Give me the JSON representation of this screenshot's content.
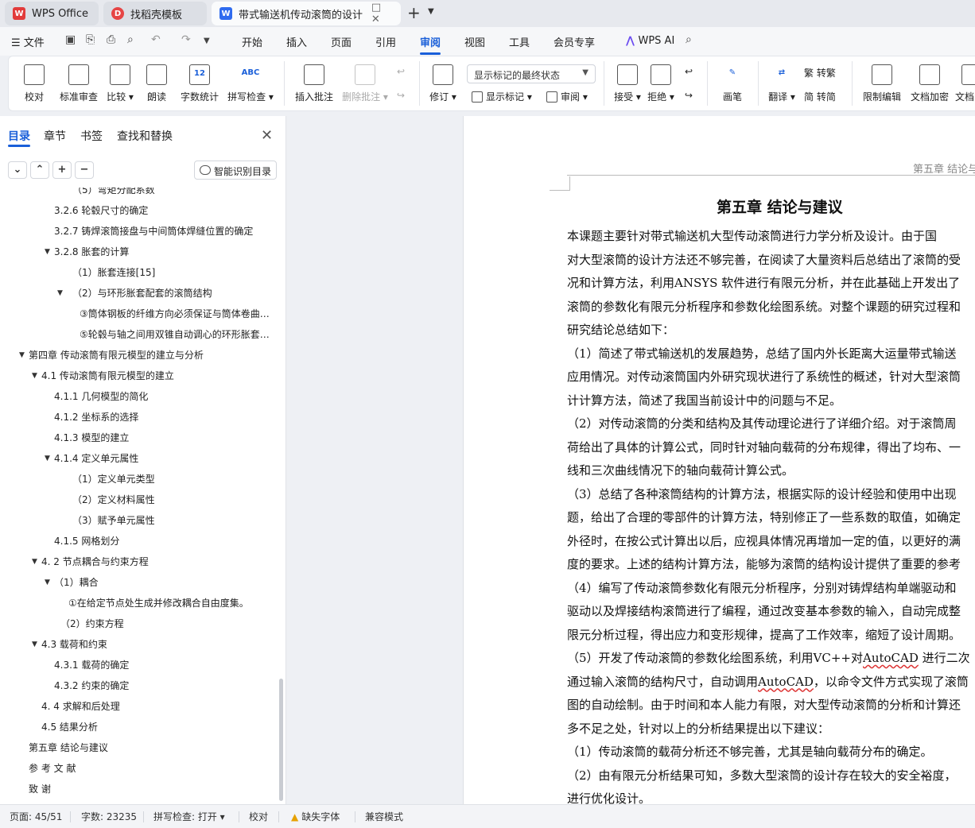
{
  "tabs": [
    {
      "title": "WPS Office",
      "logo": "W",
      "logo_color": "#e23b3b"
    },
    {
      "title": "找稻壳模板",
      "logo": "D",
      "logo_color": "#e64545"
    },
    {
      "title": "带式输送机传动滚筒的设计 说",
      "logo": "W",
      "logo_color": "#2f6bef",
      "extra": "□ ✕"
    }
  ],
  "new_tab": "+",
  "menu": {
    "file_label": "☰ 文件",
    "items": [
      "开始",
      "插入",
      "页面",
      "引用",
      "审阅",
      "视图",
      "工具",
      "会员专享"
    ],
    "active": "审阅",
    "wps_ai": "WPS AI"
  },
  "ribbon": {
    "buttons": [
      {
        "label": "校对",
        "icon": "proofread-icon"
      },
      {
        "label": "标准审查",
        "icon": "standard-review-icon"
      },
      {
        "label": "比较 ▾",
        "icon": "compare-icon"
      },
      {
        "label": "朗读",
        "icon": "read-aloud-icon"
      },
      {
        "label": "字数统计",
        "icon": "word-count-icon",
        "glyph": "12"
      },
      {
        "label": "拼写检查 ▾",
        "icon": "spell-check-icon",
        "glyph": "ABC"
      },
      {
        "label": "插入批注",
        "icon": "insert-comment-icon"
      },
      {
        "label": "删除批注 ▾",
        "icon": "delete-comment-icon"
      },
      {
        "label": "修订 ▾",
        "icon": "track-changes-icon"
      },
      {
        "label": "接受 ▾",
        "icon": "accept-icon"
      },
      {
        "label": "拒绝 ▾",
        "icon": "reject-icon"
      },
      {
        "label": "画笔",
        "icon": "pen-icon"
      },
      {
        "label": "翻译 ▾",
        "icon": "translate-icon"
      },
      {
        "label": "限制编辑",
        "icon": "restrict-edit-icon"
      },
      {
        "label": "文档加密",
        "icon": "encrypt-icon"
      },
      {
        "label": "文档",
        "icon": "doc-icon"
      }
    ],
    "markup_select": "显示标记的最终状态",
    "show_markup": "显示标记 ▾",
    "review_pane": "审阅 ▾",
    "to_traditional": "转繁",
    "to_simplified": "转简"
  },
  "nav": {
    "tabs": [
      "目录",
      "章节",
      "书签",
      "查找和替换"
    ],
    "active": "目录",
    "smart_toc": "智能识别目录",
    "toc": [
      {
        "text": "（5）弯矩分配系数",
        "level": 4,
        "tri": ""
      },
      {
        "text": "3.2.6  轮毂尺寸的确定",
        "level": 3,
        "tri": ""
      },
      {
        "text": "3.2.7  铸焊滚筒接盘与中间筒体焊缝位置的确定",
        "level": 3,
        "tri": ""
      },
      {
        "text": "3.2.8  胀套的计算",
        "level": 3,
        "tri": "▼"
      },
      {
        "text": "（1）胀套连接[15]",
        "level": 4,
        "tri": ""
      },
      {
        "text": "（2）与环形胀套配套的滚筒结构",
        "level": 4,
        "tri": "▼"
      },
      {
        "text": "③筒体钢板的纤维方向必须保证与筒体卷曲方向一致",
        "level": 5,
        "tri": ""
      },
      {
        "text": "⑤轮毂与轴之间用双锥自动调心的环形胀套连接",
        "level": 5,
        "tri": ""
      },
      {
        "text": "第四章  传动滚筒有限元模型的建立与分析",
        "level": 1,
        "tri": "▼"
      },
      {
        "text": "4.1  传动滚筒有限元模型的建立",
        "level": 2,
        "tri": "▼"
      },
      {
        "text": "4.1.1  几何模型的简化",
        "level": 3,
        "tri": ""
      },
      {
        "text": "4.1.2  坐标系的选择",
        "level": 3,
        "tri": ""
      },
      {
        "text": "4.1.3  模型的建立",
        "level": 3,
        "tri": ""
      },
      {
        "text": "4.1.4  定义单元属性",
        "level": 3,
        "tri": "▼"
      },
      {
        "text": "（1）定义单元类型",
        "level": 4,
        "tri": ""
      },
      {
        "text": "（2）定义材料属性",
        "level": 4,
        "tri": ""
      },
      {
        "text": "（3）赋予单元属性",
        "level": 4,
        "tri": ""
      },
      {
        "text": "4.1.5  网格划分",
        "level": 3,
        "tri": ""
      },
      {
        "text": "4. 2  节点耦合与约束方程",
        "level": 2,
        "tri": "▼"
      },
      {
        "text": "（1）耦合",
        "level": 3,
        "tri": "▼"
      },
      {
        "text": "①在给定节点处生成并修改耦合自由度集。",
        "level": 45,
        "tri": ""
      },
      {
        "text": "（2）约束方程",
        "level": 35,
        "tri": ""
      },
      {
        "text": "4.3  载荷和约束",
        "level": 2,
        "tri": "▼"
      },
      {
        "text": "4.3.1  载荷的确定",
        "level": 3,
        "tri": ""
      },
      {
        "text": "4.3.2  约束的确定",
        "level": 3,
        "tri": ""
      },
      {
        "text": "4. 4  求解和后处理",
        "level": 25,
        "tri": ""
      },
      {
        "text": "4.5  结果分析",
        "level": 25,
        "tri": ""
      },
      {
        "text": "第五章  结论与建议",
        "level": 15,
        "tri": ""
      },
      {
        "text": "参 考 文 献",
        "level": 15,
        "tri": ""
      },
      {
        "text": "致    谢",
        "level": 15,
        "tri": ""
      }
    ]
  },
  "document": {
    "header": "第五章  结论与建议",
    "chapter_title": "第五章  结论与建议",
    "lines": [
      "        本课题主要针对带式输送机大型传动滚筒进行力学分析及设计。由于国",
      "对大型滚筒的设计方法还不够完善，在阅读了大量资料后总结出了滚筒的受",
      "况和计算方法，利用ANSYS 软件进行有限元分析，并在此基础上开发出了",
      "滚筒的参数化有限元分析程序和参数化绘图系统。对整个课题的研究过程和",
      "研究结论总结如下：",
      "（1）简述了带式输送机的发展趋势，总结了国内外长距离大运量带式输送",
      "应用情况。对传动滚筒国内外研究现状进行了系统性的概述，针对大型滚筒",
      "计计算方法，简述了我国当前设计中的问题与不足。",
      "（2）对传动滚筒的分类和结构及其传动理论进行了详细介绍。对于滚筒周",
      "荷给出了具体的计算公式，同时针对轴向载荷的分布规律，得出了均布、一",
      "线和三次曲线情况下的轴向载荷计算公式。",
      "（3）总结了各种滚筒结构的计算方法，根据实际的设计经验和使用中出现",
      "题，给出了合理的零部件的计算方法，特别修正了一些系数的取值，如确定",
      "外径时，在按公式计算出以后，应视具体情况再增加一定的值，以更好的满",
      "度的要求。上述的结构计算方法，能够为滚筒的结构设计提供了重要的参考",
      "（4）编写了传动滚筒参数化有限元分析程序，分别对铸焊结构单端驱动和",
      "驱动以及焊接结构滚筒进行了编程，通过改变基本参数的输入，自动完成整",
      "限元分析过程，得出应力和变形规律，提高了工作效率，缩短了设计周期。",
      "（5）开发了传动滚筒的参数化绘图系统，利用VC++对AutoCAD 进行二次",
      "通过输入滚筒的结构尺寸，自动调用AutoCAD，以命令文件方式实现了滚筒",
      "图的自动绘制。由于时间和本人能力有限，对大型传动滚筒的分析和计算还",
      "多不足之处，针对以上的分析结果提出以下建议：",
      "（1）传动滚筒的载荷分析还不够完善，尤其是轴向载荷分布的确定。",
      "（2）由有限元分析结果可知，多数大型滚筒的设计存在较大的安全裕度，",
      "进行优化设计。"
    ]
  },
  "status": {
    "page": "页面: 45/51",
    "words": "字数: 23235",
    "spell": "拼写检查: 打开 ▾",
    "proof": "校对",
    "missing_font": "缺失字体",
    "compat": "兼容模式"
  },
  "colors": {
    "accent": "#1a5fd9",
    "warn": "#e6a100"
  }
}
